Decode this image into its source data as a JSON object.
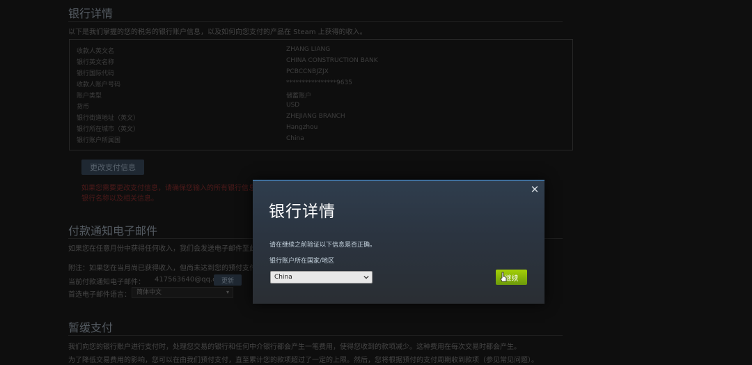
{
  "background": {
    "bank_section": {
      "title": "银行详情",
      "intro": "以下是我们掌握的您的税务的银行账户信息，以及如何向您支付的产品在 Steam 上获得的收入。",
      "rows": [
        {
          "label": "收款人英文名",
          "value": "ZHANG LIANG"
        },
        {
          "label": "银行英文名称",
          "value": "CHINA CONSTRUCTION BANK"
        },
        {
          "label": "银行国际代码",
          "value": "PCBCCNBJZJX"
        },
        {
          "label": "收款人账户号码",
          "value": "****************9635"
        },
        {
          "label": "账户类型",
          "value": "储蓄账户"
        },
        {
          "label": "货币",
          "value": "USD"
        },
        {
          "label": "银行街道地址（英文）",
          "value": "ZHEJIANG BRANCH"
        },
        {
          "label": "银行所在城市（英文）",
          "value": "Hangzhou"
        },
        {
          "label": "银行账户所属国",
          "value": "China"
        }
      ],
      "change_button": "更改支付信息",
      "warning_1": "如果您需要更改支付信息，请确保您输入的所有银行信息",
      "warning_2": "银行名称以及相关信息。"
    },
    "email_section": {
      "title": "付款通知电子邮件",
      "line1": "如果您在任意月份中获得任何收入，我们会发送电子邮件至此电子邮件",
      "line2": "附注：如果您在当月尚已获得收入，但尚未达到您的预付支付",
      "email_label": "当前付款通知电子邮件：",
      "email_value": "417563640@qq.com",
      "update_button": "更新",
      "lang_label": "首选电子邮件语言：",
      "lang_value": "简体中文"
    },
    "hold_section": {
      "title": "暂缓支付",
      "line1": "我们向您的银行账户进行支付时，处理您交易的银行和任何中介银行都会产生一笔费用，使得您收到的款项减少。这种费用在每次交易时都会产生。",
      "line2": "为了降低交易费用的影响，您可以在由我们预付支付，直至累计您的款项超过了一定的上限。然后，您将根据预付的支付周期收到款项（参见常见问题）。"
    }
  },
  "modal": {
    "title": "银行详情",
    "close_symbol": "✕",
    "description": "请在继续之前验证以下信息是否正确。",
    "country_label": "银行账户所在国家/地区",
    "country_value": "China",
    "continue_button": "继续"
  }
}
